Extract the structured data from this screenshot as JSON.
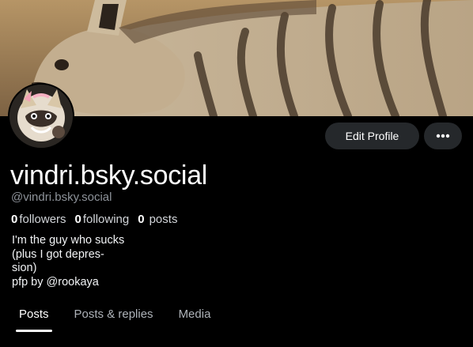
{
  "profile": {
    "display_name": "vindri.bsky.social",
    "handle": "@vindri.bsky.social",
    "banner_image": "hyena-photo",
    "avatar_image": "illustrated-hyena-character"
  },
  "actions": {
    "edit_profile_label": "Edit Profile",
    "more_icon": "ellipsis-icon"
  },
  "stats": {
    "followers_count": "0",
    "followers_label": "followers",
    "following_count": "0",
    "following_label": "following",
    "posts_count": "0",
    "posts_label": "posts"
  },
  "bio": {
    "lines": [
      "I'm the guy who sucks",
      "(plus I got depres-",
      "sion)",
      "pfp by @rookaya"
    ]
  },
  "tabs": [
    {
      "label": "Posts",
      "active": true
    },
    {
      "label": "Posts & replies",
      "active": false
    },
    {
      "label": "Media",
      "active": false
    }
  ],
  "colors": {
    "background": "#000000",
    "button_bg": "#25282b",
    "secondary_text": "#8e939a",
    "accent": "#ffffff"
  }
}
